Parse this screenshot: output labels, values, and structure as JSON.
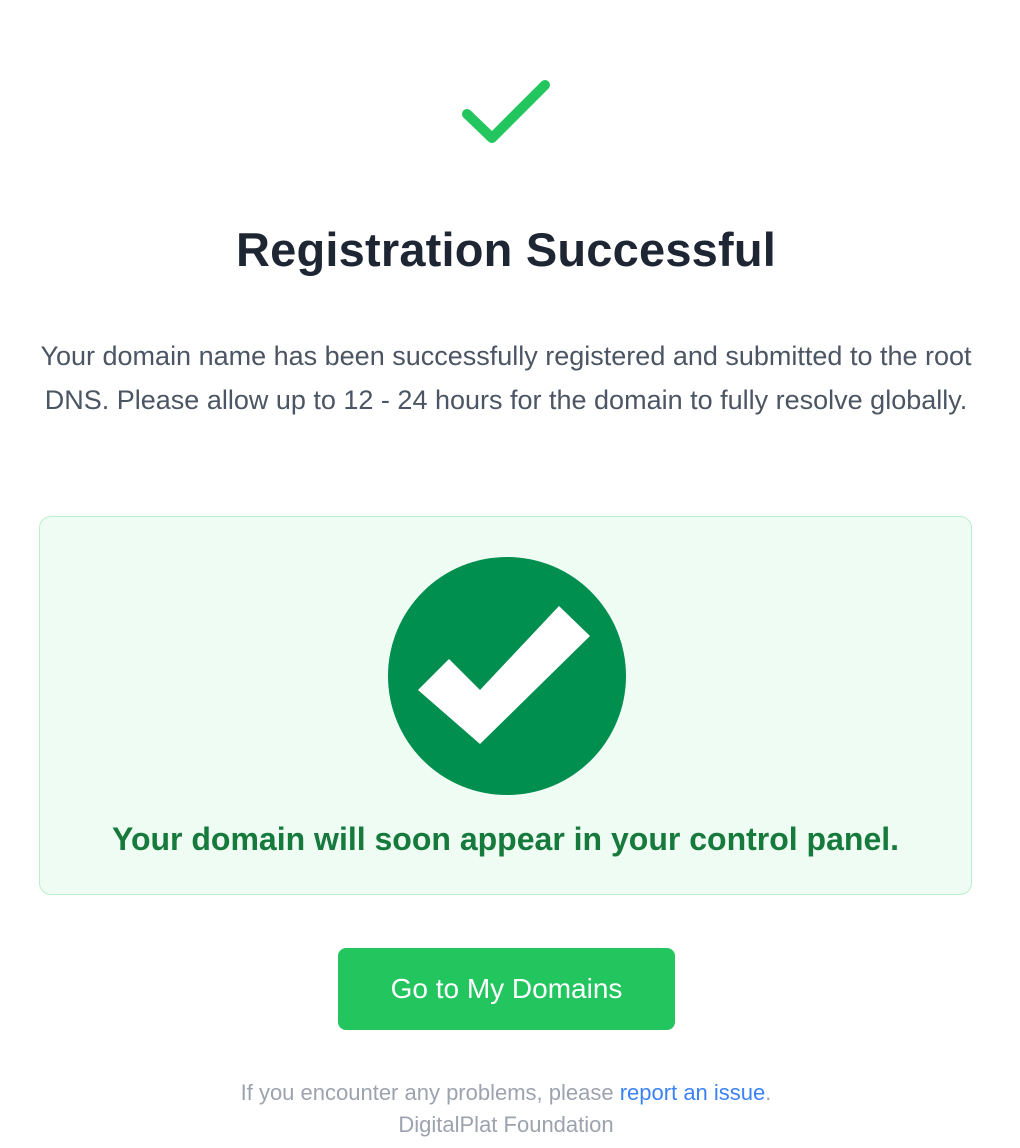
{
  "header": {
    "icon": "check-icon",
    "title": "Registration Successful"
  },
  "message": {
    "description": "Your domain name has been successfully registered and submitted to the root DNS. Please allow up to 12 - 24 hours for the domain to fully resolve globally."
  },
  "notice": {
    "icon": "check-circle-icon",
    "text": "Your domain will soon appear in your control panel."
  },
  "actions": {
    "primary_label": "Go to My Domains"
  },
  "footer": {
    "prefix": "If you encounter any problems, please ",
    "link_label": "report an issue",
    "suffix": ".",
    "organization": "DigitalPlat Foundation"
  },
  "colors": {
    "success_green": "#22c55e",
    "dark_green": "#008f4f",
    "notice_text_green": "#157a3b",
    "notice_background": "#effcf3",
    "link_blue": "#3b82f6"
  }
}
